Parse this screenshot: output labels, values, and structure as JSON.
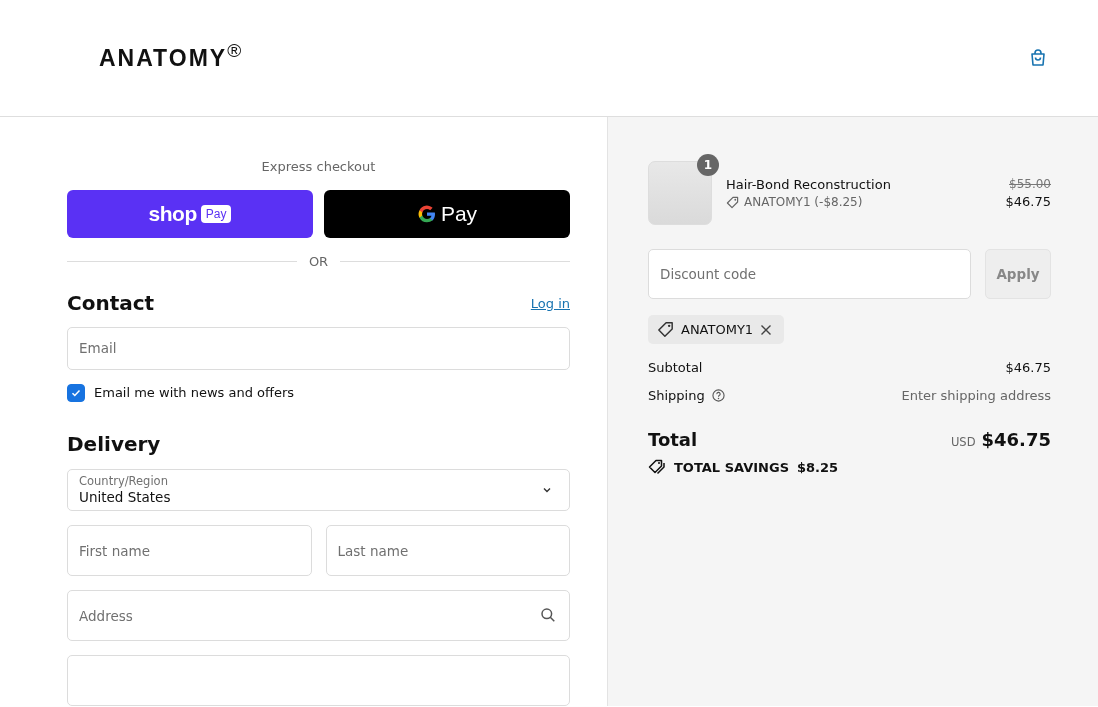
{
  "header": {
    "logo": "ANATOMY$^{®}$"
  },
  "express": {
    "title": "Express checkout",
    "shop_pay": {
      "brand": "shop",
      "badge": "Pay"
    },
    "google_pay": {
      "label": "Pay"
    },
    "divider": "OR"
  },
  "contact": {
    "heading": "Contact",
    "login": "Log in",
    "email": {
      "placeholder": "Email"
    },
    "newsletter": {
      "label": "Email me with news and offers",
      "checked": true
    }
  },
  "delivery": {
    "heading": "Delivery",
    "country": {
      "label": "Country/Region",
      "value": "United States"
    },
    "first_name": {
      "placeholder": "First name"
    },
    "last_name": {
      "placeholder": "Last name"
    },
    "address": {
      "placeholder": "Address"
    }
  },
  "summary": {
    "item": {
      "quantity": "1",
      "name": "Hair-Bond Reconstruction",
      "discount": "ANATOMY1 (-$8.25)",
      "original_price": "$55.00",
      "price": "$46.75"
    },
    "discount_field": {
      "placeholder": "Discount code"
    },
    "apply": "Apply",
    "applied_code": "ANATOMY1",
    "subtotal": {
      "label": "Subtotal",
      "value": "$46.75"
    },
    "shipping": {
      "label": "Shipping",
      "value": "Enter shipping address"
    },
    "total": {
      "label": "Total",
      "currency": "USD",
      "value": "$46.75"
    },
    "savings": {
      "label": "TOTAL SAVINGS",
      "value": "$8.25"
    }
  }
}
